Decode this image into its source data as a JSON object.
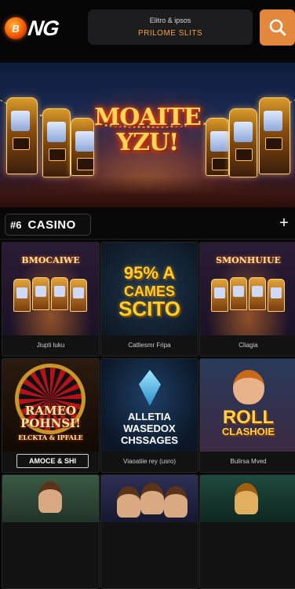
{
  "header": {
    "logo_badge": "B",
    "logo_text": "NG",
    "promo_line1": "Elitro & ipsos",
    "promo_line2": "PRILOME SLITS"
  },
  "hero": {
    "title_line1": "MOAITE",
    "title_line2": "YZU!"
  },
  "category": {
    "count": "#6",
    "label": "CASINO"
  },
  "games": [
    {
      "art": "BMOCAIWE",
      "caption": "Jiupti luku"
    },
    {
      "art_line1": "95% A",
      "art_line2": "CAMES",
      "art_line3": "SCITO",
      "caption": "Catliesmr Fripa"
    },
    {
      "art": "SMONHUIUE",
      "caption": "Cliagia"
    },
    {
      "art_line1": "RAMEO",
      "art_line2": "POHNSI!",
      "art_line3": "ELCKTA & IPFALE",
      "button": "AMOCE & SHI",
      "caption": ""
    },
    {
      "art_line1": "ALLETIA",
      "art_line2": "WASEDOX",
      "art_line3": "CHSSAGES",
      "caption": "Viaoatiie rey (usro)"
    },
    {
      "art_line1": "ROLL",
      "art_line2": "CLASHOIE",
      "caption": "Bulirsa Mved"
    }
  ],
  "colors": {
    "accent": "#e2883c",
    "promo_text": "#f2a23a",
    "background": "#070707"
  }
}
